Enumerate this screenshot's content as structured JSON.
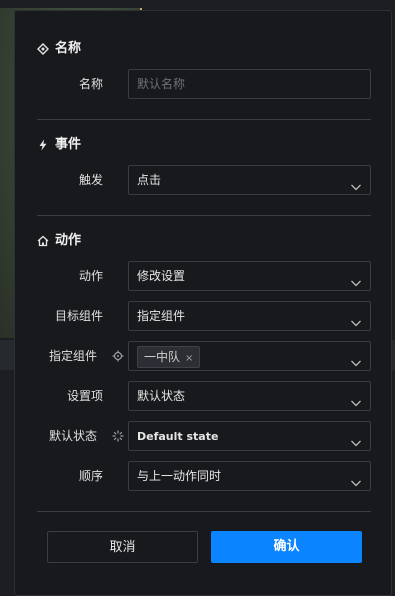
{
  "sections": {
    "name": {
      "title": "名称",
      "icon": "diamond-target-icon"
    },
    "event": {
      "title": "事件",
      "icon": "lightning-icon"
    },
    "action": {
      "title": "动作",
      "icon": "house-icon"
    }
  },
  "fields": {
    "name": {
      "label": "名称",
      "placeholder": "默认名称"
    },
    "trigger": {
      "label": "触发",
      "value": "点击"
    },
    "action": {
      "label": "动作",
      "value": "修改设置"
    },
    "target_component": {
      "label": "目标组件",
      "value": "指定组件"
    },
    "specified_component": {
      "label": "指定组件",
      "tag": "一中队",
      "tag_remove": "×",
      "icon": "crosshair-icon"
    },
    "setting_item": {
      "label": "设置项",
      "value": "默认状态"
    },
    "default_state": {
      "label": "默认状态",
      "value": "Default state",
      "icon": "loading-spinner-icon"
    },
    "order": {
      "label": "顺序",
      "value": "与上一动作同时"
    }
  },
  "buttons": {
    "cancel": "取消",
    "confirm": "确认"
  },
  "colors": {
    "primary": "#0a84ff",
    "dialog_bg": "#18191c",
    "border": "#3a3d44"
  }
}
